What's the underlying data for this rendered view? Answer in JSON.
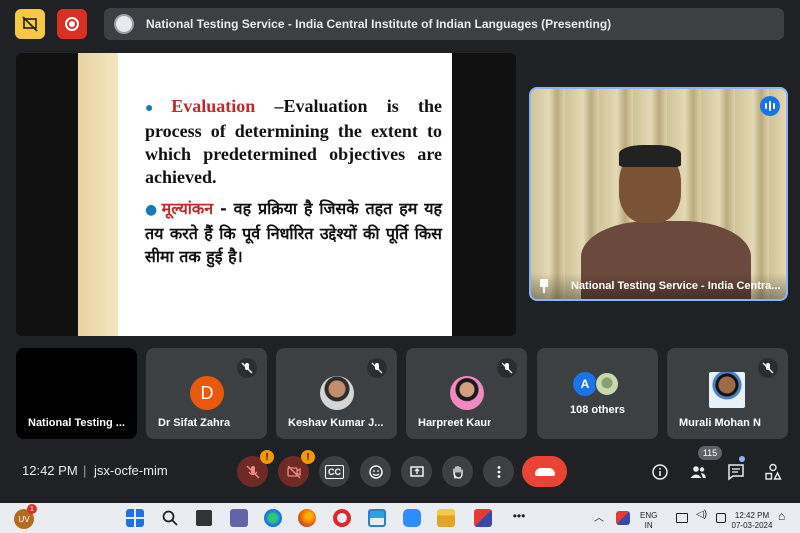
{
  "meeting": {
    "presentation_title": "National Testing Service - India Central Institute of Indian Languages (Presenting)"
  },
  "slide": {
    "term1": "Evaluation",
    "text1": " –Evaluation is the process of determining the extent to which predetermined objectives are achieved.",
    "term2": "मूल्यांकन",
    "text2": " - वह प्रक्रिया है जिसके तहत हम यह तय करते हैं कि पूर्व निर्धारित उद्देश्यों की पूर्ति किस सीमा तक हुई है।"
  },
  "speaker": {
    "name": "National Testing Service - India Centra..."
  },
  "tiles": [
    {
      "name": "National Testing ..."
    },
    {
      "name": "Dr Sifat Zahra",
      "initial": "D"
    },
    {
      "name": "Keshav Kumar J..."
    },
    {
      "name": "Harpreet Kaur"
    },
    {
      "name": "108 others",
      "initial": "A"
    },
    {
      "name": "Murali Mohan N"
    }
  ],
  "controls": {
    "time": "12:42 PM",
    "separator": "|",
    "meeting_code": "jsx-ocfe-mim",
    "mic_alert": "!",
    "cam_alert": "!",
    "cc_label": "CC",
    "people_count": "115"
  },
  "taskbar": {
    "uv_label": "UV",
    "uv_badge": "1",
    "lang_line1": "ENG",
    "lang_line2": "IN",
    "clock_time": "12:42 PM",
    "clock_date": "07-03-2024"
  },
  "colors": {
    "accent_blue": "#8ab4f8",
    "end_call_red": "#ea4335",
    "alert_orange": "#f29900",
    "slide_highlight": "#c0282b"
  }
}
